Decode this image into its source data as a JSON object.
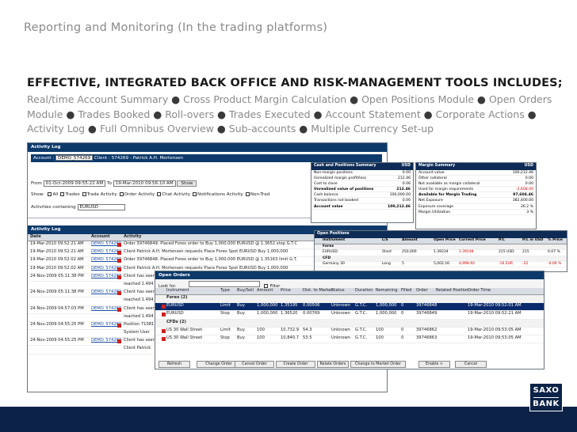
{
  "slide": {
    "title": "Reporting and Monitoring (In the trading platforms)",
    "heading": "EFFECTIVE, INTEGRATED BACK OFFICE AND RISK-MANAGEMENT TOOLS INCLUDES;",
    "features": [
      "Real/time Account Summary",
      "Cross Product Margin Calculation",
      "Open Positions Module",
      "Open Orders Module",
      "Trades Booked",
      "Roll-overs",
      "Trades Executed",
      "Account Statement",
      "Corporate Actions",
      "Activity Log",
      "Full Omnibus Overview",
      "Sub-accounts",
      "Multiple Currency Set-up"
    ],
    "bullet": "●"
  },
  "activity_log": {
    "title": "Activity Log",
    "account_label": "Account :",
    "account_value": "DEMO_574269",
    "client_label": "Client :",
    "client_value": "574269 - Patrick A.H. Mortensen",
    "from_label": "From",
    "from_value": "01-Oct-2009 09:55:22 AM",
    "to_label": "To",
    "to_value": "19-Mar-2010 09:56:10 AM",
    "show_button": "Show",
    "show_label": "Show:",
    "filters": [
      "All",
      "Trades",
      "Trade Activity",
      "Order Activity",
      "Chat Activity",
      "Notifications Activity",
      "Non-Trad"
    ],
    "contains_label": "Activities containing",
    "contains_value": "EURUSD",
    "list_title": "Activity Log",
    "columns": [
      "Date",
      "Account",
      "Activity"
    ],
    "rows": [
      {
        "date": "19-Mar-2010 09:52:21 AM",
        "account": "DEMO_574269",
        "activity": "Order 39746849: Placed Forex order to Buy 1,000,000 EURUSD @ 1.3652 stop G.T.C"
      },
      {
        "date": "19-Mar-2010 09:52:21 AM",
        "account": "DEMO_574269",
        "activity": "Client Patrick A.H. Mortensen requests Place Forex Spot EURUSD Buy 1,000,000"
      },
      {
        "date": "19-Mar-2010 09:52:02 AM",
        "account": "DEMO_574269",
        "activity": "Order 39746848: Placed Forex order to Buy 1,000,000 EURUSD @ 1.35163 limit G.T."
      },
      {
        "date": "19-Mar-2010 09:52:02 AM",
        "account": "DEMO_574269",
        "activity": "Client Patrick A.H. Mortensen requests Place Forex Spot EURUSD Buy 1,000,000"
      },
      {
        "date": "24-Nov-2009 05:11:38 PM",
        "account": "DEMO_574269",
        "activity": "Client has seen",
        "extra": "reached 1.494"
      },
      {
        "date": "24-Nov-2009 05:11:38 PM",
        "account": "DEMO_574269",
        "activity": "Client has seen",
        "extra": "reached 1.494"
      },
      {
        "date": "24-Nov-2009 04:57:03 PM",
        "account": "DEMO_574269",
        "activity": "Client has seen",
        "extra": "reached 1.494"
      },
      {
        "date": "24-Nov-2009 04:55:25 PM",
        "account": "DEMO_574269",
        "activity": "Position 71081",
        "extra": "System User"
      },
      {
        "date": "24-Nov-2009 04:55:25 PM",
        "account": "DEMO_574269",
        "activity": "Client has seen",
        "extra": "Client Patrick"
      }
    ]
  },
  "cash_summary": {
    "title": "Cash and Positions Summary",
    "currency": "USD",
    "rows": [
      {
        "label": "Non-margin positions",
        "value": "0.00"
      },
      {
        "label": "Unrealized margin profit/loss",
        "value": "212.46"
      },
      {
        "label": "Cost to close",
        "value": "0.06"
      },
      {
        "label": "Unrealized value of positions",
        "value": "212.46"
      },
      {
        "label": "Cash balance",
        "value": "100,000.00"
      },
      {
        "label": "Transactions not booked",
        "value": "0.00"
      },
      {
        "label": "Account value",
        "value": "100,212.46"
      }
    ]
  },
  "margin_summary": {
    "title": "Margin Summary",
    "currency": "USD",
    "rows": [
      {
        "label": "Account value",
        "value": "100,212.46"
      },
      {
        "label": "Other collateral",
        "value": "0.00"
      },
      {
        "label": "Not available as margin collateral",
        "value": "0.00"
      },
      {
        "label": "Used for margin requirements",
        "value": "-2,608.00"
      },
      {
        "label": "Available for Margin Trading",
        "value": "97,604.46"
      },
      {
        "label": "Net Exposure",
        "value": "382,400.00"
      },
      {
        "label": "Exposure coverage",
        "value": "26.2 %"
      },
      {
        "label": "Margin Utilization",
        "value": "3 %"
      }
    ]
  },
  "open_positions": {
    "title": "Open Positions",
    "columns": [
      "Instrument",
      "L/S",
      "Amount",
      "Open Price",
      "Current Price",
      "P/L",
      "P/L in USD",
      "% Price"
    ],
    "groups": [
      {
        "name": "Forex",
        "instrument": "EURUSD",
        "ls": "Short",
        "amount": "250,000",
        "open": "1.39234",
        "current": "1.39148",
        "pl": "215 USD",
        "plusd": "215",
        "pct": "0.07 %"
      },
      {
        "name": "CFD",
        "instrument": "Germany 30",
        "ls": "Long",
        "amount": "5",
        "open": "5,002.16",
        "current": "4,998.92",
        "pl": "-16 EUR",
        "plusd": "-22",
        "pct": "-0.06 %"
      }
    ]
  },
  "open_orders": {
    "title": "Open Orders",
    "look_for_label": "Look for:",
    "filter_label": "Filter",
    "columns": [
      "Instrument",
      "Type",
      "Buy/Sell",
      "Amount",
      "Price",
      "Dist. to Market",
      "Status",
      "Duration",
      "Remaining",
      "Filled",
      "Order",
      "Related Position",
      "Order Time"
    ],
    "groups": [
      {
        "label": "Forex (2)",
        "rows": [
          {
            "inst": "EURUSD",
            "type": "Limit",
            "side": "Buy",
            "amount": "1,000,000",
            "price": "1.35195",
            "dist": "0.00506",
            "status": "Unknown",
            "dur": "G.T.C.",
            "rem": "1,000,000",
            "filled": "0",
            "order": "39746848",
            "time": "19-Mar-2010 09:52:01 AM"
          },
          {
            "inst": "EURUSD",
            "type": "Stop",
            "side": "Buy",
            "amount": "1,000,000",
            "price": "1.36520",
            "dist": "0.00769",
            "status": "Unknown",
            "dur": "G.T.C.",
            "rem": "1,000,000",
            "filled": "0",
            "order": "39746849",
            "time": "19-Mar-2010 09:52:21 AM"
          }
        ]
      },
      {
        "label": "CFDs (2)",
        "rows": [
          {
            "inst": "US 30 Wall Street",
            "type": "Limit",
            "side": "Buy",
            "amount": "100",
            "price": "10,732.9",
            "dist": "54.3",
            "status": "Unknown",
            "dur": "G.T.C.",
            "rem": "100",
            "filled": "0",
            "order": "39746862",
            "time": "19-Mar-2010 09:53:05 AM"
          },
          {
            "inst": "US 30 Wall Street",
            "type": "Stop",
            "side": "Buy",
            "amount": "100",
            "price": "10,840.7",
            "dist": "53.5",
            "status": "Unknown",
            "dur": "G.T.C.",
            "rem": "100",
            "filled": "0",
            "order": "39746863",
            "time": "19-Mar-2010 09:53:05 AM"
          }
        ]
      }
    ],
    "buttons": [
      "Refresh",
      "Change Order",
      "Cancel Order",
      "Create Order",
      "Relate Orders",
      "Change to Market Order",
      "Enable >",
      "Cancel"
    ]
  },
  "brand": {
    "line1": "SAXO",
    "line2": "BANK"
  },
  "colors": {
    "navy": "#0c2347",
    "gray_text": "#8a8a8a",
    "window_title": "#0d3a6b"
  }
}
